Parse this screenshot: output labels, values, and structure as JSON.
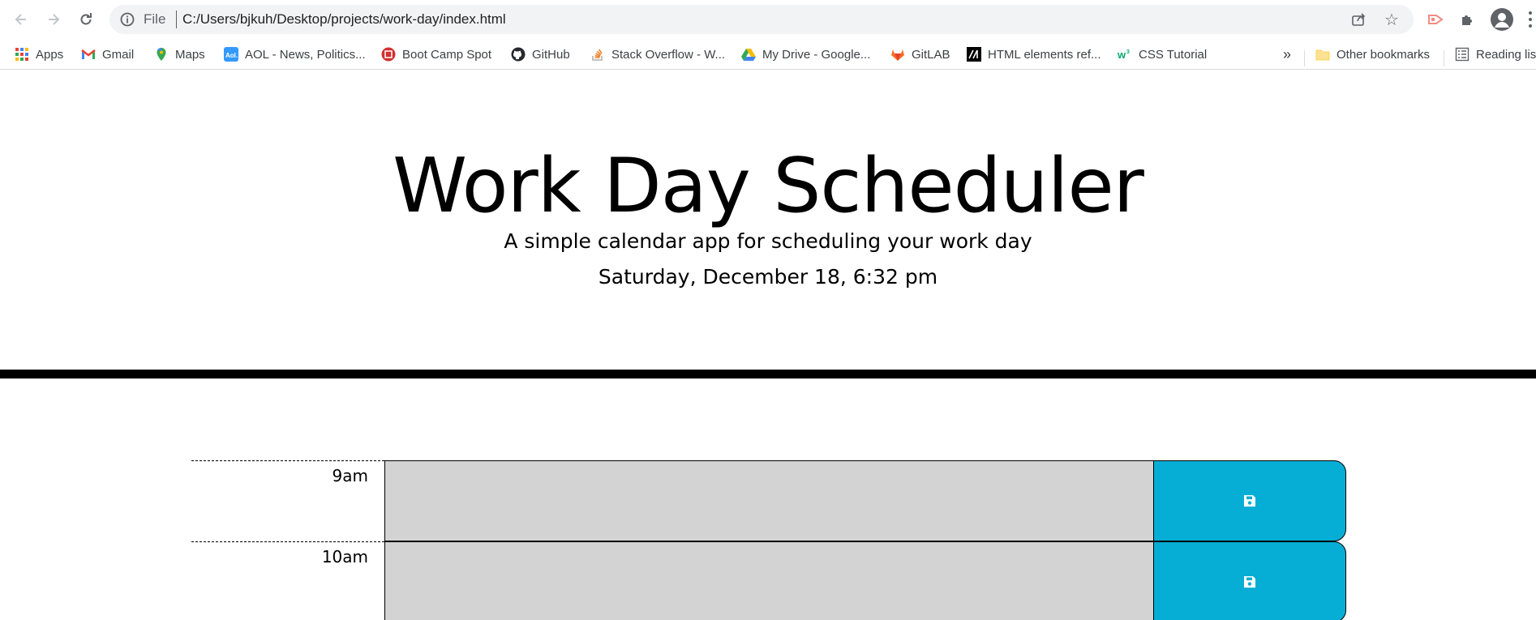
{
  "browser": {
    "file_label": "File",
    "url": "C:/Users/bjkuh/Desktop/projects/work-day/index.html",
    "bookmarks": [
      {
        "label": "Apps",
        "icon": "apps-grid-icon"
      },
      {
        "label": "Gmail",
        "icon": "gmail-icon"
      },
      {
        "label": "Maps",
        "icon": "maps-icon"
      },
      {
        "label": "AOL - News, Politics...",
        "icon": "aol-icon"
      },
      {
        "label": "Boot Camp Spot",
        "icon": "bootcamp-icon"
      },
      {
        "label": "GitHub",
        "icon": "github-icon"
      },
      {
        "label": "Stack Overflow - W...",
        "icon": "stackoverflow-icon"
      },
      {
        "label": "My Drive - Google...",
        "icon": "google-drive-icon"
      },
      {
        "label": "GitLAB",
        "icon": "gitlab-icon"
      },
      {
        "label": "HTML elements ref...",
        "icon": "mdn-icon"
      },
      {
        "label": "CSS Tutorial",
        "icon": "w3schools-icon"
      }
    ],
    "overflow_label": "»",
    "other_bookmarks": "Other bookmarks",
    "reading_list": "Reading list"
  },
  "page": {
    "title": "Work Day Scheduler",
    "subtitle": "A simple calendar app for scheduling your work day",
    "current_day": "Saturday, December 18, 6:32 pm"
  },
  "time_blocks": [
    {
      "hour": "9am",
      "description": "",
      "save_icon": "floppy-disk-icon"
    },
    {
      "hour": "10am",
      "description": "",
      "save_icon": "floppy-disk-icon"
    }
  ],
  "colors": {
    "past_block": "#d3d3d3",
    "save_button": "#06aed5",
    "header_rule": "#000000"
  }
}
